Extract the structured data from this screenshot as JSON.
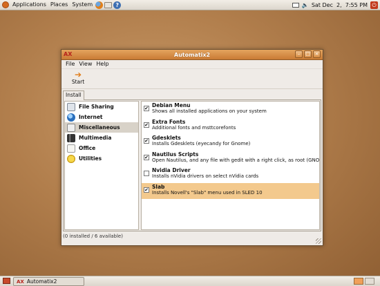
{
  "top_panel": {
    "menus": [
      "Applications",
      "Places",
      "System"
    ],
    "clock": "Sat Dec  2,  7:55 PM"
  },
  "window": {
    "title": "Automatix2",
    "menu": [
      "File",
      "View",
      "Help"
    ],
    "toolbar": {
      "start_label": "Start"
    },
    "tab_label": "Install",
    "categories": [
      {
        "label": "File Sharing",
        "icon": "file-sharing-icon"
      },
      {
        "label": "Internet",
        "icon": "internet-icon"
      },
      {
        "label": "Miscellaneous",
        "icon": "miscellaneous-icon",
        "selected": true
      },
      {
        "label": "Multimedia",
        "icon": "multimedia-icon"
      },
      {
        "label": "Office",
        "icon": "office-icon"
      },
      {
        "label": "Utilities",
        "icon": "utilities-icon"
      }
    ],
    "packages": [
      {
        "name": "Debian Menu",
        "desc": "Shows all installed applications on your system",
        "checked": true
      },
      {
        "name": "Extra Fonts",
        "desc": "Additional fonts and msttcorefonts",
        "checked": true
      },
      {
        "name": "Gdesklets",
        "desc": "Installs Gdesklets (eyecandy for Gnome)",
        "checked": true
      },
      {
        "name": "Nautilus Scripts",
        "desc": "Open Nautilus, and any file with gedit with a right click, as root (GNOME C",
        "checked": true
      },
      {
        "name": "Nvidia Driver",
        "desc": "Installs nVidia drivers on select nVidia cards",
        "checked": false
      },
      {
        "name": "Slab",
        "desc": "Installs Novell's \"Slab\" menu used in SLED 10",
        "checked": true,
        "selected": true
      }
    ],
    "status": "(0 installed / 6 available)"
  },
  "bottom_panel": {
    "task_label": "Automatix2"
  },
  "colors": {
    "titlebar": "#d68c43",
    "selection": "#f3c98d",
    "desktop": "#b17e4c"
  }
}
